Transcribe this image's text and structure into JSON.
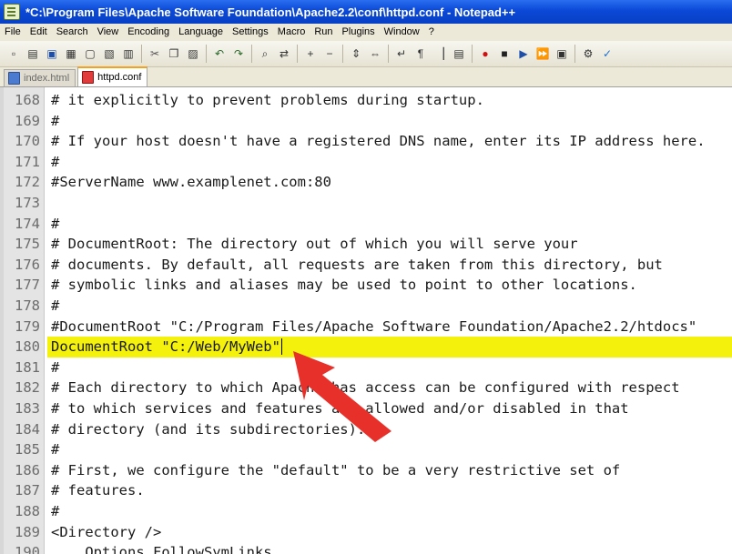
{
  "window": {
    "title": "*C:\\Program Files\\Apache Software Foundation\\Apache2.2\\conf\\httpd.conf - Notepad++"
  },
  "menu": [
    "File",
    "Edit",
    "Search",
    "View",
    "Encoding",
    "Language",
    "Settings",
    "Macro",
    "Run",
    "Plugins",
    "Window",
    "?"
  ],
  "toolbar_icons": [
    "new-file-icon",
    "open-file-icon",
    "save-icon",
    "save-all-icon",
    "close-icon",
    "close-all-icon",
    "print-icon",
    "|",
    "cut-icon",
    "copy-icon",
    "paste-icon",
    "|",
    "undo-icon",
    "redo-icon",
    "|",
    "find-icon",
    "replace-icon",
    "|",
    "zoom-in-icon",
    "zoom-out-icon",
    "|",
    "sync-vertical-icon",
    "sync-horizontal-icon",
    "|",
    "word-wrap-icon",
    "show-all-chars-icon",
    "indent-guide-icon",
    "document-map-icon",
    "|",
    "record-macro-icon",
    "stop-macro-icon",
    "play-macro-icon",
    "play-multiple-icon",
    "save-macro-icon",
    "|",
    "tool-icon",
    "spell-check-icon"
  ],
  "tabs": [
    {
      "label": "index.html",
      "active": false,
      "modified": false
    },
    {
      "label": "httpd.conf",
      "active": true,
      "modified": true
    }
  ],
  "editor": {
    "highlight_color": "#f4f20c",
    "lines": [
      {
        "num": "168",
        "text": "# it explicitly to prevent problems during startup."
      },
      {
        "num": "169",
        "text": "#"
      },
      {
        "num": "170",
        "text": "# If your host doesn't have a registered DNS name, enter its IP address here."
      },
      {
        "num": "171",
        "text": "#"
      },
      {
        "num": "172",
        "text": "#ServerName www.examplenet.com:80"
      },
      {
        "num": "173",
        "text": ""
      },
      {
        "num": "174",
        "text": "#"
      },
      {
        "num": "175",
        "text": "# DocumentRoot: The directory out of which you will serve your"
      },
      {
        "num": "176",
        "text": "# documents. By default, all requests are taken from this directory, but"
      },
      {
        "num": "177",
        "text": "# symbolic links and aliases may be used to point to other locations."
      },
      {
        "num": "178",
        "text": "#"
      },
      {
        "num": "179",
        "text": "#DocumentRoot \"C:/Program Files/Apache Software Foundation/Apache2.2/htdocs\""
      },
      {
        "num": "180",
        "text": "DocumentRoot \"C:/Web/MyWeb\"",
        "highlight": true
      },
      {
        "num": "181",
        "text": "#"
      },
      {
        "num": "182",
        "text": "# Each directory to which Apache has access can be configured with respect"
      },
      {
        "num": "183",
        "text": "# to which services and features are allowed and/or disabled in that"
      },
      {
        "num": "184",
        "text": "# directory (and its subdirectories)."
      },
      {
        "num": "185",
        "text": "#"
      },
      {
        "num": "186",
        "text": "# First, we configure the \"default\" to be a very restrictive set of"
      },
      {
        "num": "187",
        "text": "# features."
      },
      {
        "num": "188",
        "text": "#"
      },
      {
        "num": "189",
        "text": "<Directory />"
      },
      {
        "num": "190",
        "text": "    Options FollowSymLinks"
      }
    ]
  },
  "annotation": {
    "type": "arrow",
    "color": "#e8302a",
    "points_to": "end of line 180"
  }
}
